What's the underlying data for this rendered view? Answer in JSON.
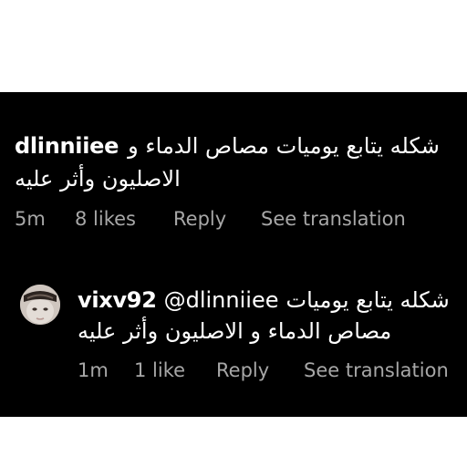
{
  "comment": {
    "username": "dlinniiee",
    "text_line1": "شكله يتابع يوميات مصاص الدماء و",
    "text_line2": "الاصليون وأثر عليه",
    "time": "5m",
    "likes": "8 likes",
    "reply_label": "Reply",
    "translate_label": "See translation"
  },
  "reply": {
    "username": "vixv92",
    "mention": "@dlinniiee",
    "text_line1": "شكله يتابع يوميات",
    "text_line2": "مصاص الدماء و الاصليون وأثر عليه",
    "time": "1m",
    "likes": "1 like",
    "reply_label": "Reply",
    "translate_label": "See translation"
  },
  "colors": {
    "background": "#000000",
    "text": "#ffffff",
    "meta": "#a7a7a7",
    "frame": "#ffffff"
  }
}
